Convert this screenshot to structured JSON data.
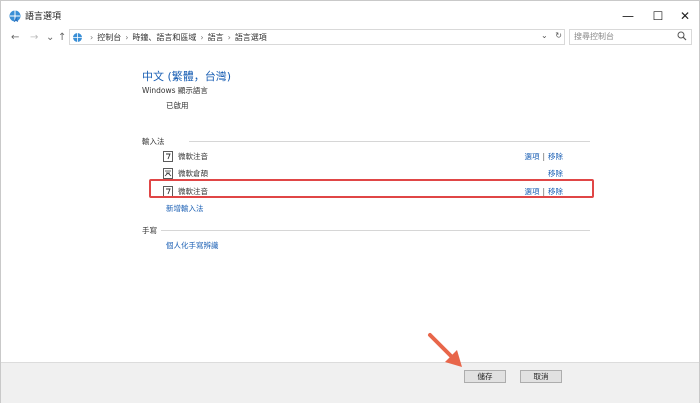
{
  "window": {
    "title": "語言選項",
    "controls": {
      "minimize": "—",
      "maximize": "☐",
      "close": "✕"
    }
  },
  "address_bar": {
    "back": "←",
    "forward": "→",
    "recent": "⌄",
    "up": "↑",
    "crumbs": [
      "控制台",
      "時鐘、語言和區域",
      "語言",
      "語言選項"
    ],
    "dropdown": "⌄",
    "refresh": "↻"
  },
  "search": {
    "placeholder": "搜尋控制台"
  },
  "language": {
    "title": "中文 (繁體，台灣)"
  },
  "display_language": {
    "label": "Windows 顯示語言",
    "status": "已啟用"
  },
  "input_methods": {
    "label": "輸入法",
    "items": [
      {
        "name": "微軟注音",
        "options": "選項",
        "remove": "移除"
      },
      {
        "name": "微軟倉頡",
        "options": "",
        "remove": "移除"
      },
      {
        "name": "微軟注音",
        "options": "選項",
        "remove": "移除"
      }
    ],
    "add_link": "新增輸入法"
  },
  "handwriting": {
    "label": "手寫",
    "personalize_link": "個人化手寫辨識"
  },
  "footer": {
    "save": "儲存",
    "cancel": "取消"
  },
  "colors": {
    "accent": "#1a5fb4",
    "highlight": "#e04646",
    "arrow": "#e8664a"
  }
}
